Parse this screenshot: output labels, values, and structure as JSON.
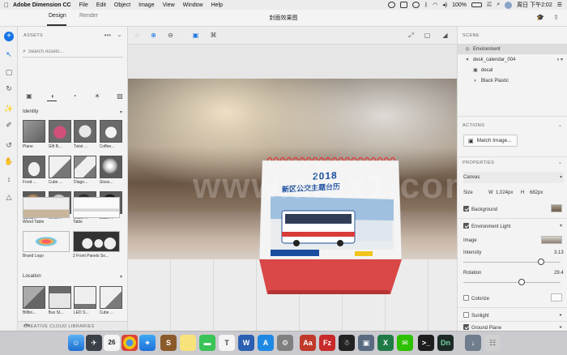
{
  "menubar": {
    "app_name": "Adobe Dimension CC",
    "items": [
      "File",
      "Edit",
      "Object",
      "Image",
      "View",
      "Window",
      "Help"
    ],
    "battery": "100%",
    "clock": "周日 下午2:02"
  },
  "titlebar": {
    "tabs": [
      "Design",
      "Render"
    ],
    "document_title": "封面效果图"
  },
  "assets": {
    "header": "ASSETS",
    "more": "•••",
    "search_placeholder": "Search Assets...",
    "identity": {
      "title": "Identity",
      "items": [
        "Plane",
        "Gift B...",
        "Twist ...",
        "Coffee...",
        "Food ...",
        "Cube ...",
        "Diago...",
        "Gloss...",
        "Cardb...",
        "White...",
        "Black ...",
        "Black ..."
      ],
      "wide_items": [
        "Wood Table",
        "Table",
        "Brand Logo",
        "2 Front Panels So..."
      ]
    },
    "location": {
      "title": "Location",
      "items": [
        "Billbo...",
        "Bus St...",
        "LED S...",
        "Cube ..."
      ]
    },
    "cc_libraries": "CREATIVE CLOUD LIBRARIES"
  },
  "viewport": {
    "calendar_year": "2018",
    "calendar_heading": "新区公交主题台历",
    "watermark": "www.alex1.com"
  },
  "scene": {
    "header": "SCENE",
    "items": [
      {
        "label": "Environment",
        "level": 0
      },
      {
        "label": "desk_calendar_004",
        "level": 0
      },
      {
        "label": "decal",
        "level": 1
      },
      {
        "label": "Black Plastic",
        "level": 1
      }
    ]
  },
  "actions": {
    "header": "ACTIONS",
    "match_image": "Match Image..."
  },
  "properties": {
    "header": "PROPERTIES",
    "canvas_label": "Canvas",
    "size_label": "Size",
    "width_label": "W",
    "width_value": "1,024px",
    "height_label": "H",
    "height_value": "682px",
    "background_label": "Background",
    "env_light_label": "Environment Light",
    "image_label": "Image",
    "intensity_label": "Intensity",
    "intensity_value": "3.13",
    "intensity_fraction": 0.8,
    "rotation_label": "Rotation",
    "rotation_value": "29.4",
    "rotation_fraction": 0.6,
    "colorize_label": "Colorize",
    "sunlight_label": "Sunlight",
    "ground_plane_label": "Ground Plane"
  },
  "dock": {
    "calendar_day": "26"
  }
}
